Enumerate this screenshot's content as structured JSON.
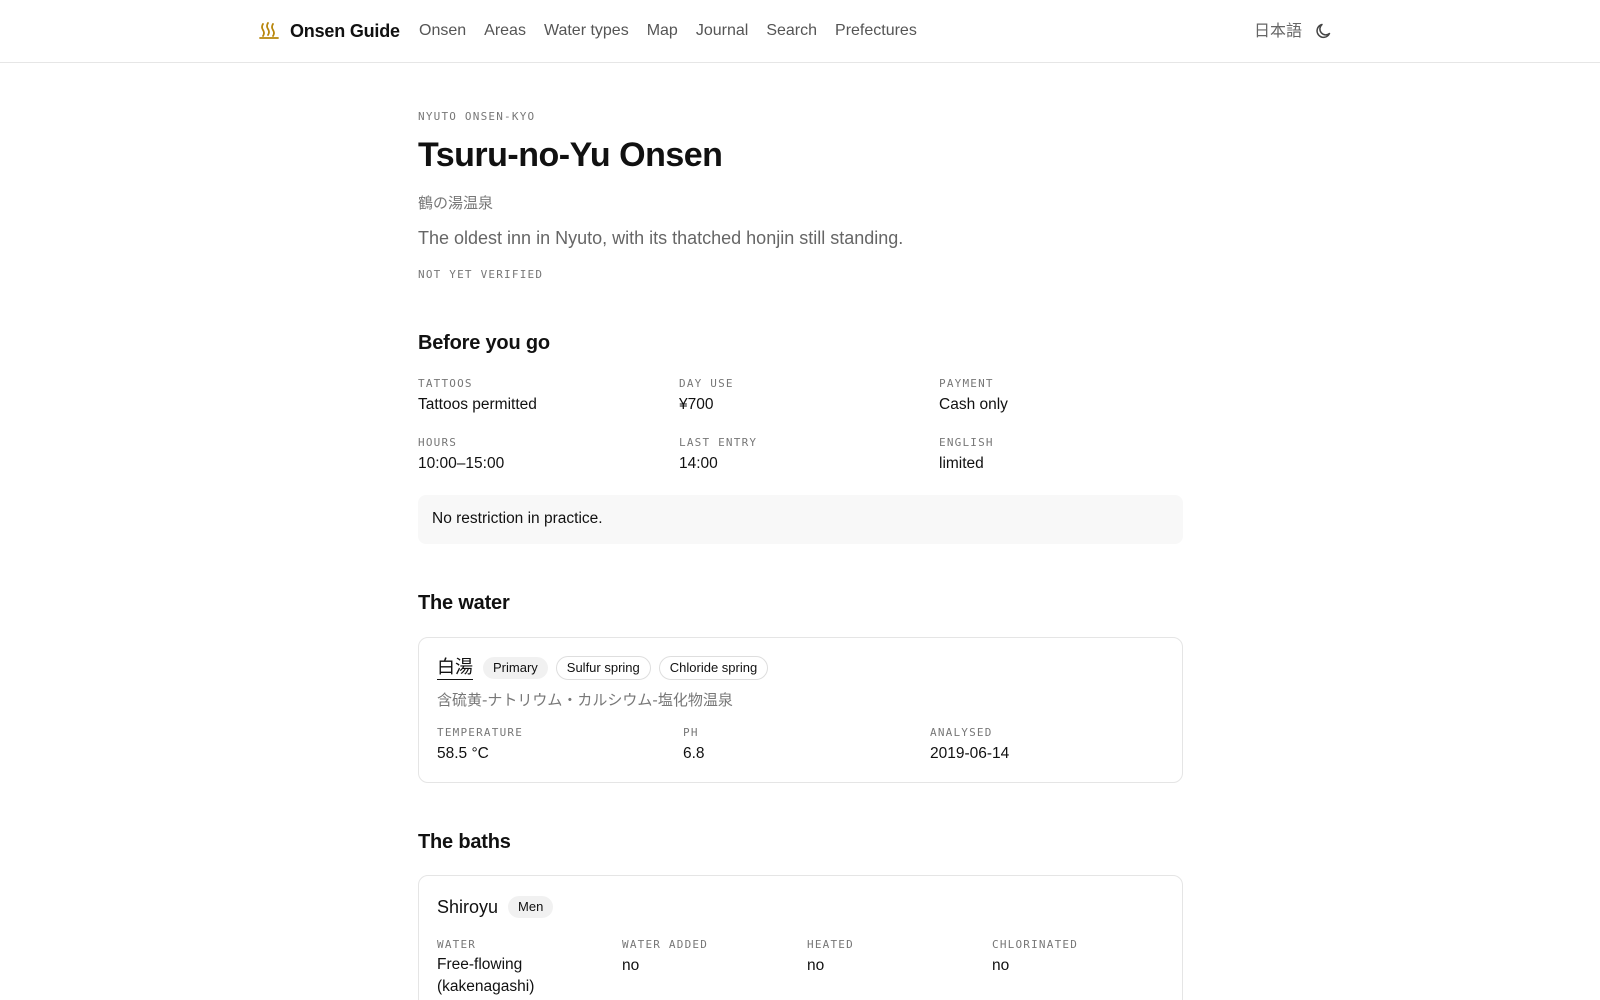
{
  "header": {
    "brand_icon": "hot-springs-icon",
    "brand_name": "Onsen Guide",
    "nav": [
      "Onsen",
      "Areas",
      "Water types",
      "Map",
      "Journal",
      "Search",
      "Prefectures"
    ],
    "language": "日本語",
    "theme_icon": "moon-icon",
    "accent_color": "#b8860b"
  },
  "page": {
    "eyebrow": "NYUTO ONSEN-KYO",
    "title": "Tsuru-no-Yu Onsen",
    "jp_name": "鶴の湯温泉",
    "tagline": "The oldest inn in Nyuto, with its thatched honjin still standing.",
    "verified": "NOT YET VERIFIED"
  },
  "before": {
    "heading": "Before you go",
    "facts": [
      {
        "label": "TATTOOS",
        "value": "Tattoos permitted"
      },
      {
        "label": "DAY USE",
        "value": "¥700"
      },
      {
        "label": "PAYMENT",
        "value": "Cash only"
      },
      {
        "label": "HOURS",
        "value": "10:00–15:00"
      },
      {
        "label": "LAST ENTRY",
        "value": "14:00"
      },
      {
        "label": "ENGLISH",
        "value": "limited"
      }
    ],
    "note": "No restriction in practice."
  },
  "water": {
    "heading": "The water",
    "source": {
      "name": "白湯",
      "tags": [
        "Primary",
        "Sulfur spring",
        "Chloride spring"
      ],
      "classification": "含硫黄-ナトリウム・カルシウム-塩化物温泉",
      "stats": [
        {
          "label": "TEMPERATURE",
          "value": "58.5 °C"
        },
        {
          "label": "PH",
          "value": "6.8"
        },
        {
          "label": "ANALYSED",
          "value": "2019-06-14"
        }
      ]
    }
  },
  "baths": {
    "heading": "The baths",
    "items": [
      {
        "name": "Shiroyu",
        "tag": "Men",
        "stats": [
          {
            "label": "WATER",
            "value": "Free-flowing",
            "value2": "(kakenagashi)"
          },
          {
            "label": "WATER ADDED",
            "value": "no"
          },
          {
            "label": "HEATED",
            "value": "no"
          },
          {
            "label": "CHLORINATED",
            "value": "no"
          }
        ]
      }
    ]
  }
}
